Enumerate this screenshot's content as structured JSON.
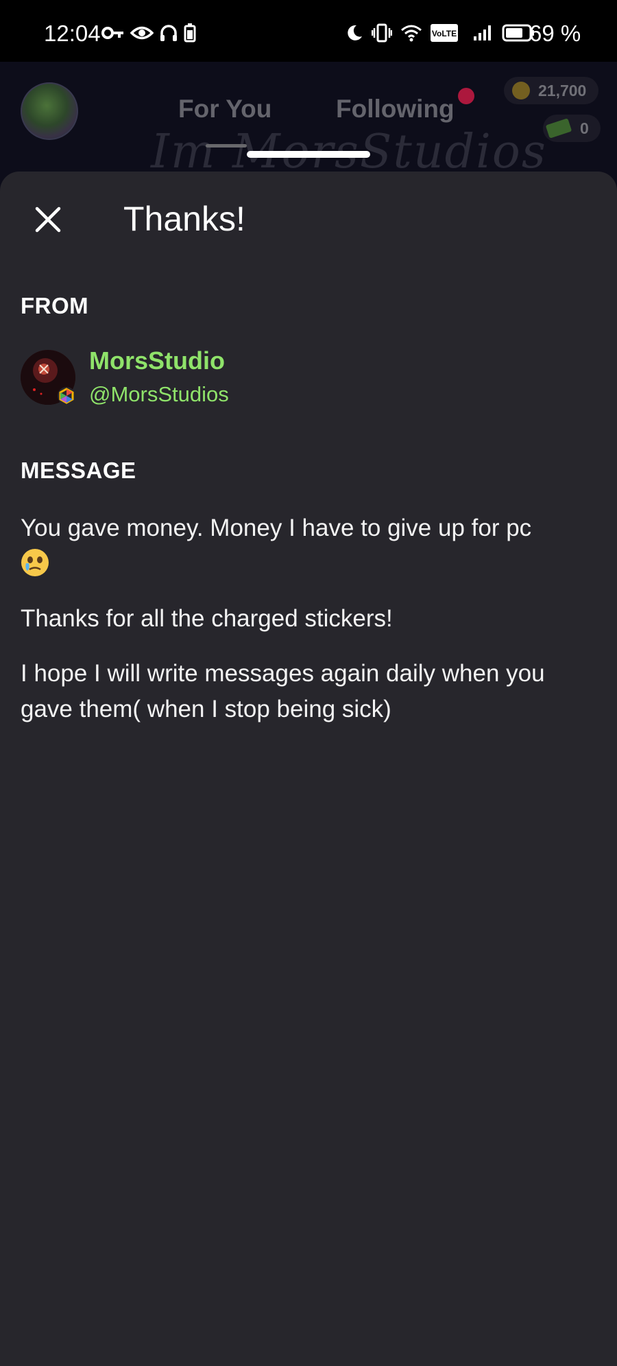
{
  "status_bar": {
    "time": "12:04",
    "battery_text": "69 %",
    "volte_label": "VoLTE"
  },
  "background_app": {
    "tabs": [
      {
        "label": "For You"
      },
      {
        "label": "Following"
      }
    ],
    "coins": "21,700",
    "cash": "0",
    "banner_text": "Im MorsStudios"
  },
  "sheet": {
    "title": "Thanks!",
    "from_label": "FROM",
    "sender": {
      "name": "MorsStudio",
      "handle": "@MorsStudios"
    },
    "message_label": "MESSAGE",
    "message_paragraphs": [
      "You gave money. Money I have to give up for pc",
      "Thanks for all the charged stickers!",
      "I hope I will write messages again daily when you gave them( when I stop being sick)"
    ],
    "emoji_name": "face-holding-back-tears-emoji"
  },
  "colors": {
    "sheet_bg": "#27262c",
    "accent_green": "#8fe36a",
    "notification_red": "#b8173f"
  }
}
